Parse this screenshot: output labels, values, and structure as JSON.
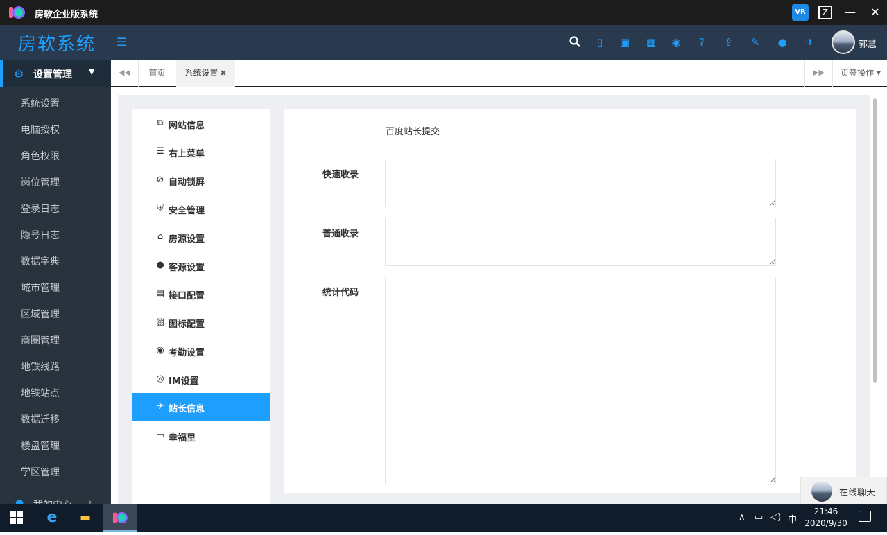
{
  "window": {
    "title": "房软企业版系统"
  },
  "header": {
    "brand": "房软系统",
    "user_name": "郭慧"
  },
  "sidebar": {
    "group_label": "设置管理",
    "items": [
      {
        "label": "系统设置"
      },
      {
        "label": "电脑授权"
      },
      {
        "label": "角色权限"
      },
      {
        "label": "岗位管理"
      },
      {
        "label": "登录日志"
      },
      {
        "label": "隐号日志"
      },
      {
        "label": "数据字典"
      },
      {
        "label": "城市管理"
      },
      {
        "label": "区域管理"
      },
      {
        "label": "商圈管理"
      },
      {
        "label": "地铁线路"
      },
      {
        "label": "地铁站点"
      },
      {
        "label": "数据迁移"
      },
      {
        "label": "楼盘管理"
      },
      {
        "label": "学区管理"
      }
    ],
    "next_group_label": "我的中心"
  },
  "tabs": {
    "home_label": "首页",
    "active_label": "系统设置",
    "ops_label": "页签操作"
  },
  "settings_nav": {
    "active_index": 10,
    "items": [
      {
        "label": "网站信息",
        "icon": "website-icon"
      },
      {
        "label": "右上菜单",
        "icon": "list-icon"
      },
      {
        "label": "自动锁屏",
        "icon": "ban-icon"
      },
      {
        "label": "安全管理",
        "icon": "shield-icon"
      },
      {
        "label": "房源设置",
        "icon": "home-icon"
      },
      {
        "label": "客源设置",
        "icon": "user-icon"
      },
      {
        "label": "接口配置",
        "icon": "api-icon"
      },
      {
        "label": "图标配置",
        "icon": "image-icon"
      },
      {
        "label": "考勤设置",
        "icon": "location-icon"
      },
      {
        "label": "IM设置",
        "icon": "chat-icon"
      },
      {
        "label": "站长信息",
        "icon": "plane-icon"
      },
      {
        "label": "幸福里",
        "icon": "monitor-icon"
      }
    ]
  },
  "form": {
    "baidu_value": "百度站长提交",
    "fast_index_label": "快速收录",
    "fast_index_value": "",
    "normal_index_label": "普通收录",
    "normal_index_value": "",
    "stats_code_label": "统计代码",
    "stats_code_value": ""
  },
  "chat": {
    "label": "在线聊天"
  },
  "taskbar": {
    "ime": "中",
    "time": "21:46",
    "date": "2020/9/30"
  },
  "colors": {
    "accent": "#1e9fff",
    "header_bg": "#2a3a4e",
    "sidebar_bg": "#28333e"
  }
}
